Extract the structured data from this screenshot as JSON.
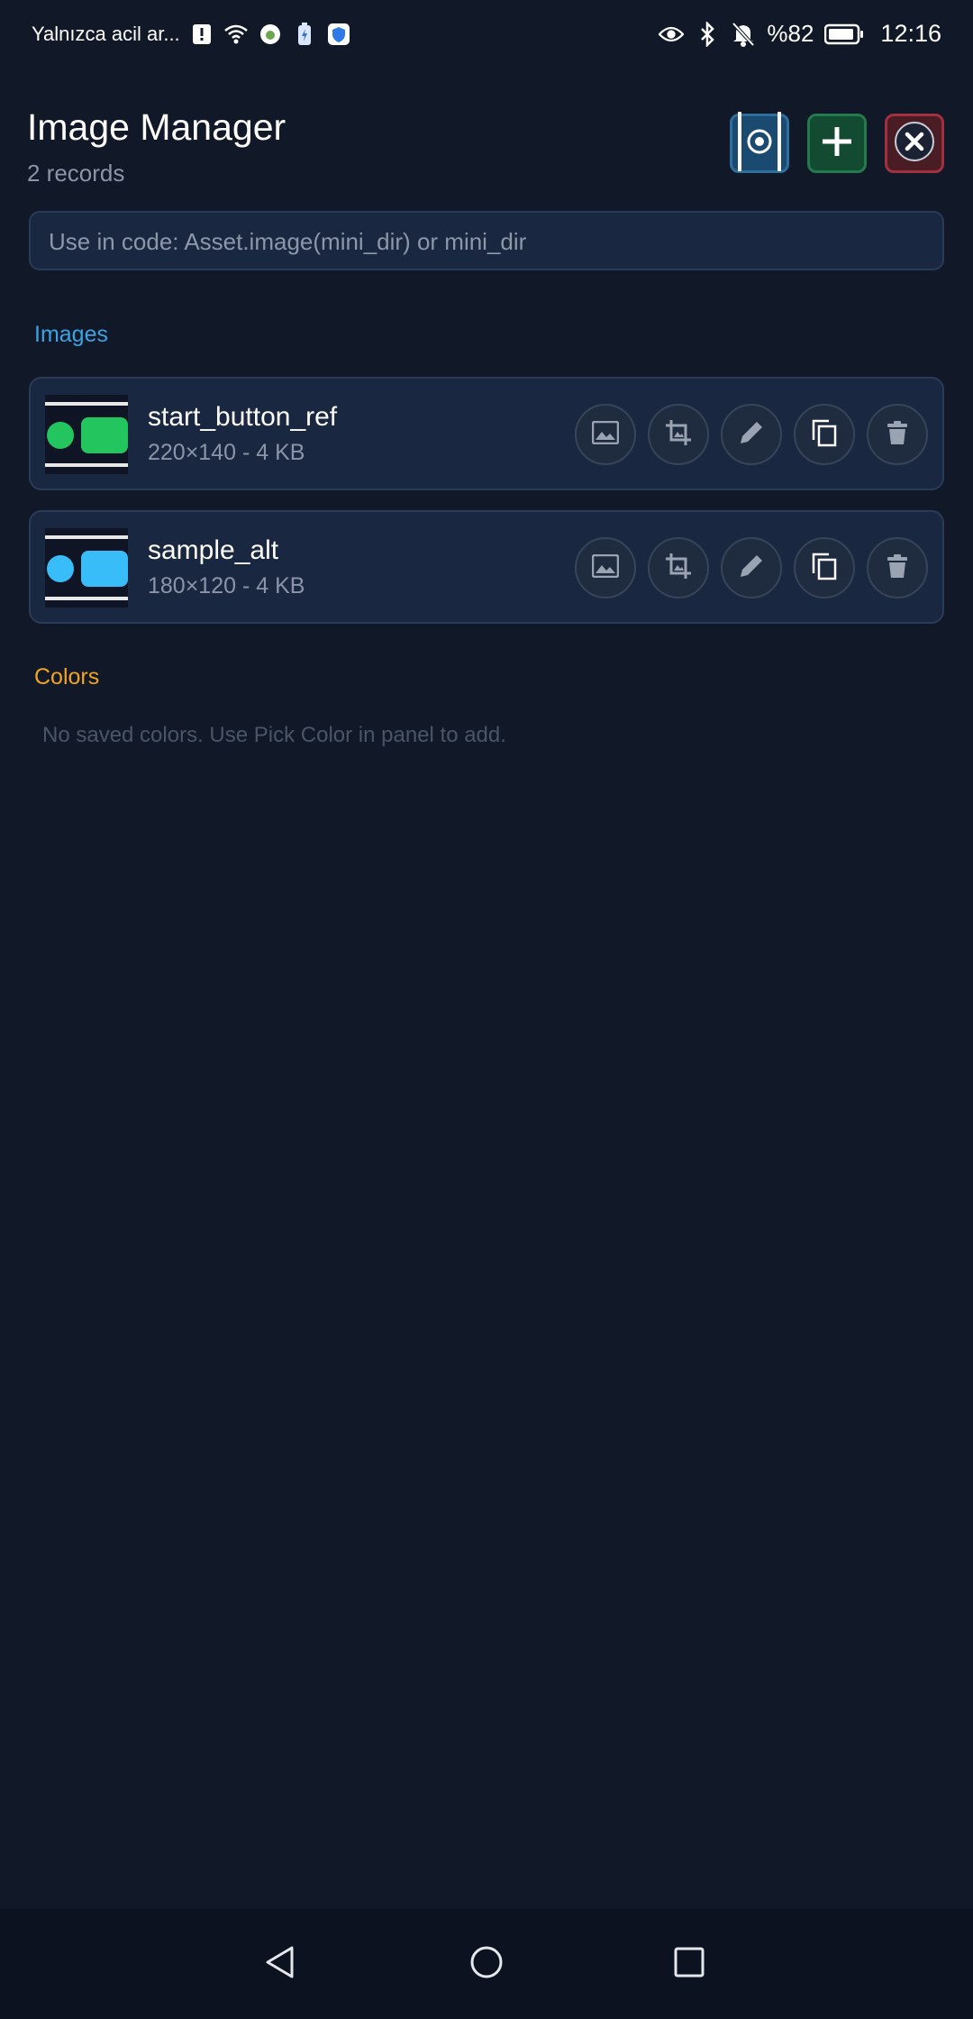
{
  "status_bar": {
    "carrier": "Yalnızca acil ar...",
    "battery_text": "%82",
    "time": "12:16",
    "icons": [
      "alert-icon",
      "wifi-icon",
      "app-icon",
      "battery-saver-icon",
      "shield-icon",
      "eye-icon",
      "bluetooth-icon",
      "bell-off-icon",
      "battery-icon"
    ]
  },
  "header": {
    "title": "Image Manager",
    "subtitle": "2 records",
    "buttons": {
      "preview": "preview-icon",
      "add": "plus-icon",
      "close": "close-icon"
    }
  },
  "code_hint": "Use in code: Asset.image(mini_dir) or mini_dir",
  "sections": {
    "images_label": "Images",
    "colors_label": "Colors"
  },
  "images": [
    {
      "name": "start_button_ref",
      "meta": "220×140 - 4 KB",
      "thumb_color": "#22c55e"
    },
    {
      "name": "sample_alt",
      "meta": "180×120 - 4 KB",
      "thumb_color": "#38bdf8"
    }
  ],
  "row_actions": [
    "image-icon",
    "crop-icon",
    "edit-icon",
    "copy-icon",
    "delete-icon"
  ],
  "colors_empty": "No saved colors. Use Pick Color in panel to add.",
  "colors": {
    "background": "#111827",
    "accent_images": "#3aa3e3",
    "accent_colors": "#f1a51e"
  }
}
